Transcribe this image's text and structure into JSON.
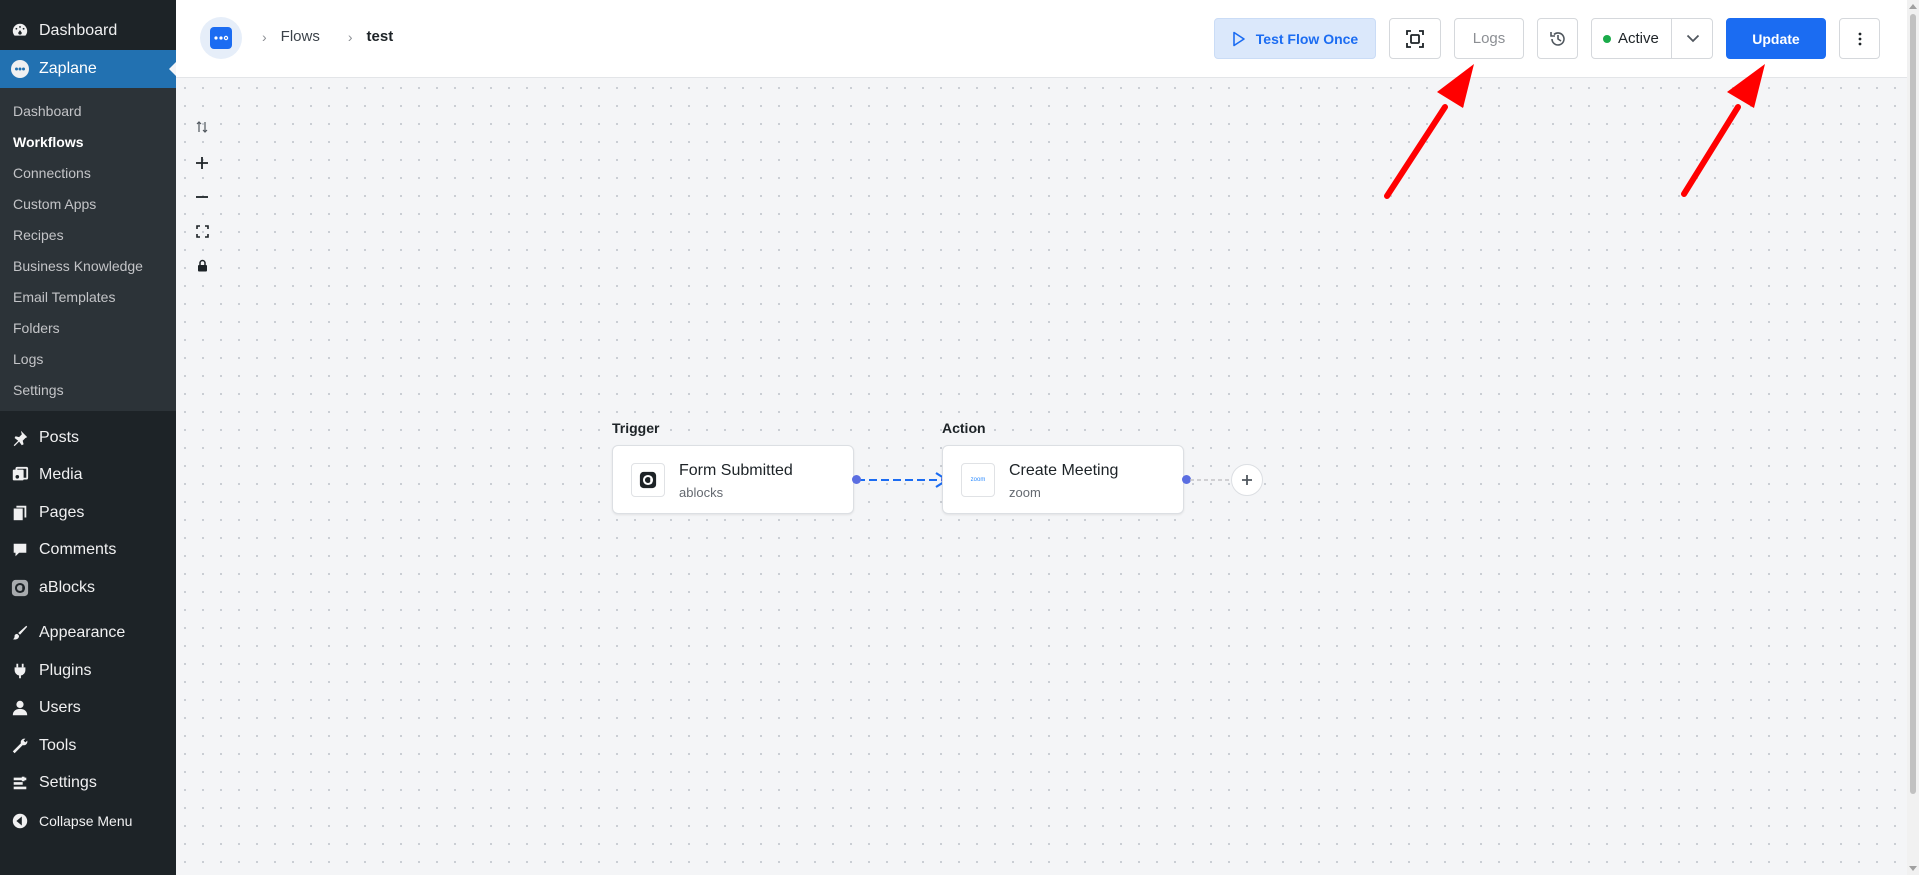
{
  "sidebar": {
    "top_items": [
      {
        "label": "Dashboard",
        "icon": "dashboard-icon"
      },
      {
        "label": "Zaplane",
        "icon": "zaplane-icon"
      }
    ],
    "submenu": [
      "Dashboard",
      "Workflows",
      "Connections",
      "Custom Apps",
      "Recipes",
      "Business Knowledge",
      "Email Templates",
      "Folders",
      "Logs",
      "Settings"
    ],
    "group1": [
      {
        "label": "Posts",
        "icon": "pin-icon"
      },
      {
        "label": "Media",
        "icon": "media-icon"
      },
      {
        "label": "Pages",
        "icon": "pages-icon"
      },
      {
        "label": "Comments",
        "icon": "comment-icon"
      },
      {
        "label": "aBlocks",
        "icon": "ablocks-icon"
      }
    ],
    "group2": [
      {
        "label": "Appearance",
        "icon": "brush-icon"
      },
      {
        "label": "Plugins",
        "icon": "plug-icon"
      },
      {
        "label": "Users",
        "icon": "user-icon"
      },
      {
        "label": "Tools",
        "icon": "wrench-icon"
      },
      {
        "label": "Settings",
        "icon": "settings-icon"
      },
      {
        "label": "Collapse Menu",
        "icon": "collapse-icon"
      }
    ]
  },
  "header": {
    "breadcrumb": [
      "Flows",
      "test"
    ],
    "test_flow_label": "Test Flow Once",
    "logs_label": "Logs",
    "status_label": "Active",
    "update_label": "Update"
  },
  "flow": {
    "trigger": {
      "step_label": "Trigger",
      "title": "Form Submitted",
      "app": "ablocks"
    },
    "action": {
      "step_label": "Action",
      "title": "Create Meeting",
      "app": "zoom",
      "icon_text": "zoom"
    }
  },
  "colors": {
    "sidebar_bg": "#1d2327",
    "sidebar_active": "#2271b1",
    "primary": "#1b6cf2",
    "status_green": "#1bab4a",
    "handle": "#5b6ee1",
    "annotation_arrow": "#ff0000"
  }
}
